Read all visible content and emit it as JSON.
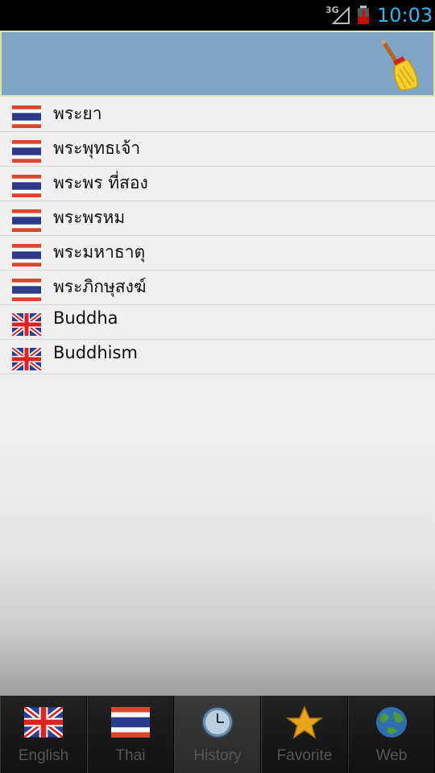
{
  "status_bar": {
    "network": "3G",
    "time": "10:03"
  },
  "history": {
    "items": [
      {
        "lang": "th",
        "text": "พระยา"
      },
      {
        "lang": "th",
        "text": "พระพุทธเจ้า"
      },
      {
        "lang": "th",
        "text": "พระพร ที่สอง"
      },
      {
        "lang": "th",
        "text": "พระพรหม"
      },
      {
        "lang": "th",
        "text": "พระมหาธาตุ"
      },
      {
        "lang": "th",
        "text": "พระภิกษุสงฆ์"
      },
      {
        "lang": "en",
        "text": "Buddha"
      },
      {
        "lang": "en",
        "text": "Buddhism"
      }
    ]
  },
  "tabs": [
    {
      "id": "english",
      "label": "English",
      "icon": "uk-flag-icon"
    },
    {
      "id": "thai",
      "label": "Thai",
      "icon": "thai-flag-icon"
    },
    {
      "id": "history",
      "label": "History",
      "icon": "clock-icon",
      "active": true
    },
    {
      "id": "favorite",
      "label": "Favorite",
      "icon": "star-icon"
    },
    {
      "id": "web",
      "label": "Web",
      "icon": "globe-icon"
    }
  ],
  "colors": {
    "header_bg": "#7ea4c6",
    "clock": "#33b5e5"
  }
}
